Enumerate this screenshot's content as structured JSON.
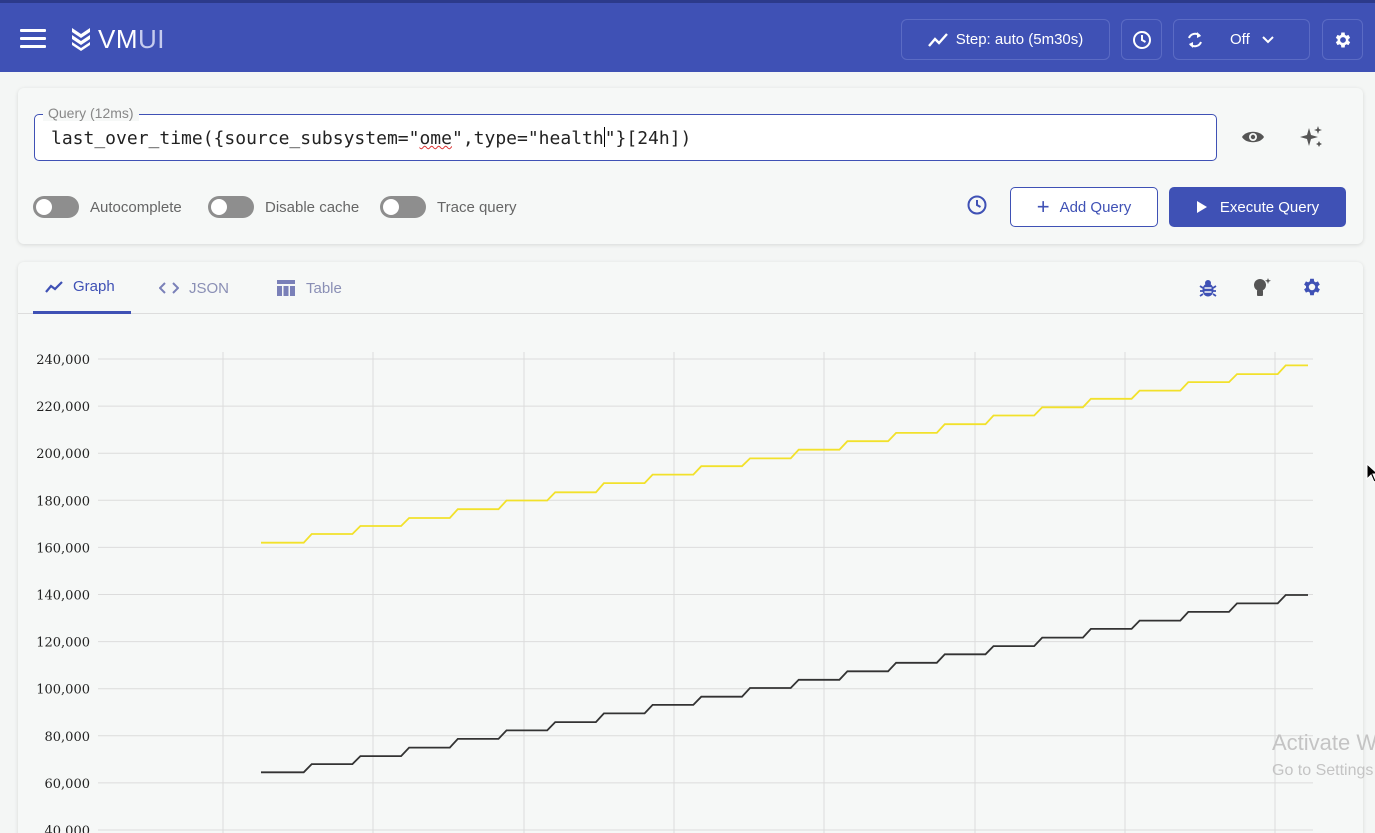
{
  "app": {
    "logo_main": "VM",
    "logo_suffix": "UI"
  },
  "header": {
    "step_label": "Step: auto (5m30s)",
    "refresh_value": "Off"
  },
  "query": {
    "legend": "Query (12ms)",
    "text_before": "last_over_time({source_subsystem=\"",
    "text_squiggle": "ome",
    "text_mid": "\",type=\"health",
    "text_after": "\"}[24h])"
  },
  "toggles": [
    {
      "label": "Autocomplete",
      "on": false
    },
    {
      "label": "Disable cache",
      "on": false
    },
    {
      "label": "Trace query",
      "on": false
    }
  ],
  "buttons": {
    "add_query": "Add Query",
    "execute_query": "Execute Query"
  },
  "tabs": [
    {
      "label": "Graph",
      "active": true
    },
    {
      "label": "JSON",
      "active": false
    },
    {
      "label": "Table",
      "active": false
    }
  ],
  "colors": {
    "accent": "#3f51b5",
    "series_yellow": "#f2e12b",
    "series_dark": "#333333"
  },
  "chart_data": {
    "type": "line",
    "y_ticks": [
      "240,000",
      "220,000",
      "200,000",
      "180,000",
      "160,000",
      "140,000",
      "120,000",
      "100,000",
      "80,000",
      "60,000",
      "40,000"
    ],
    "ylim": [
      40000,
      240000
    ],
    "grid": true,
    "step": true,
    "series": [
      {
        "color": "#f2e12b",
        "values": [
          162000,
          165700,
          169100,
          172500,
          176200,
          179900,
          183400,
          187300,
          190900,
          194500,
          197800,
          201500,
          205100,
          208600,
          212300,
          216000,
          219500,
          223100,
          226600,
          230200,
          233600,
          237300
        ]
      },
      {
        "color": "#333333",
        "values": [
          64500,
          68000,
          71400,
          75000,
          78700,
          82300,
          85800,
          89500,
          93100,
          96600,
          100300,
          103800,
          107400,
          111000,
          114600,
          118100,
          121700,
          125400,
          128900,
          132600,
          136200,
          139800
        ]
      }
    ]
  },
  "watermark": {
    "line1": "Activate W",
    "line2": "Go to Settings"
  }
}
